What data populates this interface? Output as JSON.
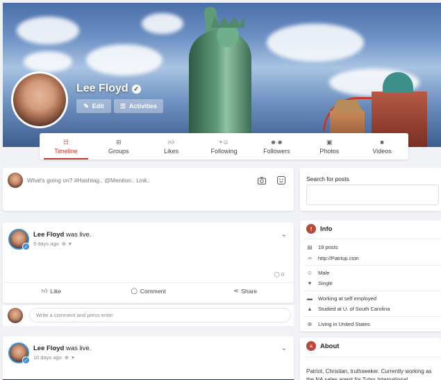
{
  "profile": {
    "name": "Lee Floyd",
    "edit_label": "Edit",
    "activities_label": "Activities",
    "verified_icon": "verified-check-icon"
  },
  "tabs": [
    {
      "label": "Timeline",
      "icon": "timeline-icon",
      "active": true
    },
    {
      "label": "Groups",
      "icon": "groups-icon",
      "active": false
    },
    {
      "label": "Likes",
      "icon": "thumbs-up-icon",
      "active": false
    },
    {
      "label": "Following",
      "icon": "user-plus-icon",
      "active": false
    },
    {
      "label": "Followers",
      "icon": "users-icon",
      "active": false
    },
    {
      "label": "Photos",
      "icon": "image-icon",
      "active": false
    },
    {
      "label": "Videos",
      "icon": "video-icon",
      "active": false
    }
  ],
  "composer": {
    "placeholder": "What's going on? #Hashtag.. @Mention.. Link.."
  },
  "posts": [
    {
      "author": "Lee Floyd",
      "action": "was live.",
      "time": "9 days ago",
      "comment_count": "0",
      "like_label": "Like",
      "comment_label": "Comment",
      "share_label": "Share"
    },
    {
      "author": "Lee Floyd",
      "action": "was live.",
      "time": "10 days ago"
    }
  ],
  "comment_box": {
    "placeholder": "Write a comment and press enter"
  },
  "search": {
    "title": "Search for posts"
  },
  "info": {
    "title": "Info",
    "rows": [
      {
        "icon": "posts-icon",
        "text": "19 posts"
      },
      {
        "icon": "link-icon",
        "text": "http://Patriup.com"
      },
      {
        "icon": "gender-icon",
        "text": "Male"
      },
      {
        "icon": "heart-icon",
        "text": "Single"
      },
      {
        "icon": "briefcase-icon",
        "text": "Working at self employed"
      },
      {
        "icon": "graduation-cap-icon",
        "text": "Studied at U. of South Carolina"
      },
      {
        "icon": "globe-icon",
        "text": "Living in United States"
      }
    ]
  },
  "about": {
    "title": "About",
    "text": "Patriot, Christian, truthseeker. Currently working as the NA sales agent for Tytax International"
  },
  "colors": {
    "accent": "#c0392b",
    "verified_blue": "#3b8fd8"
  }
}
